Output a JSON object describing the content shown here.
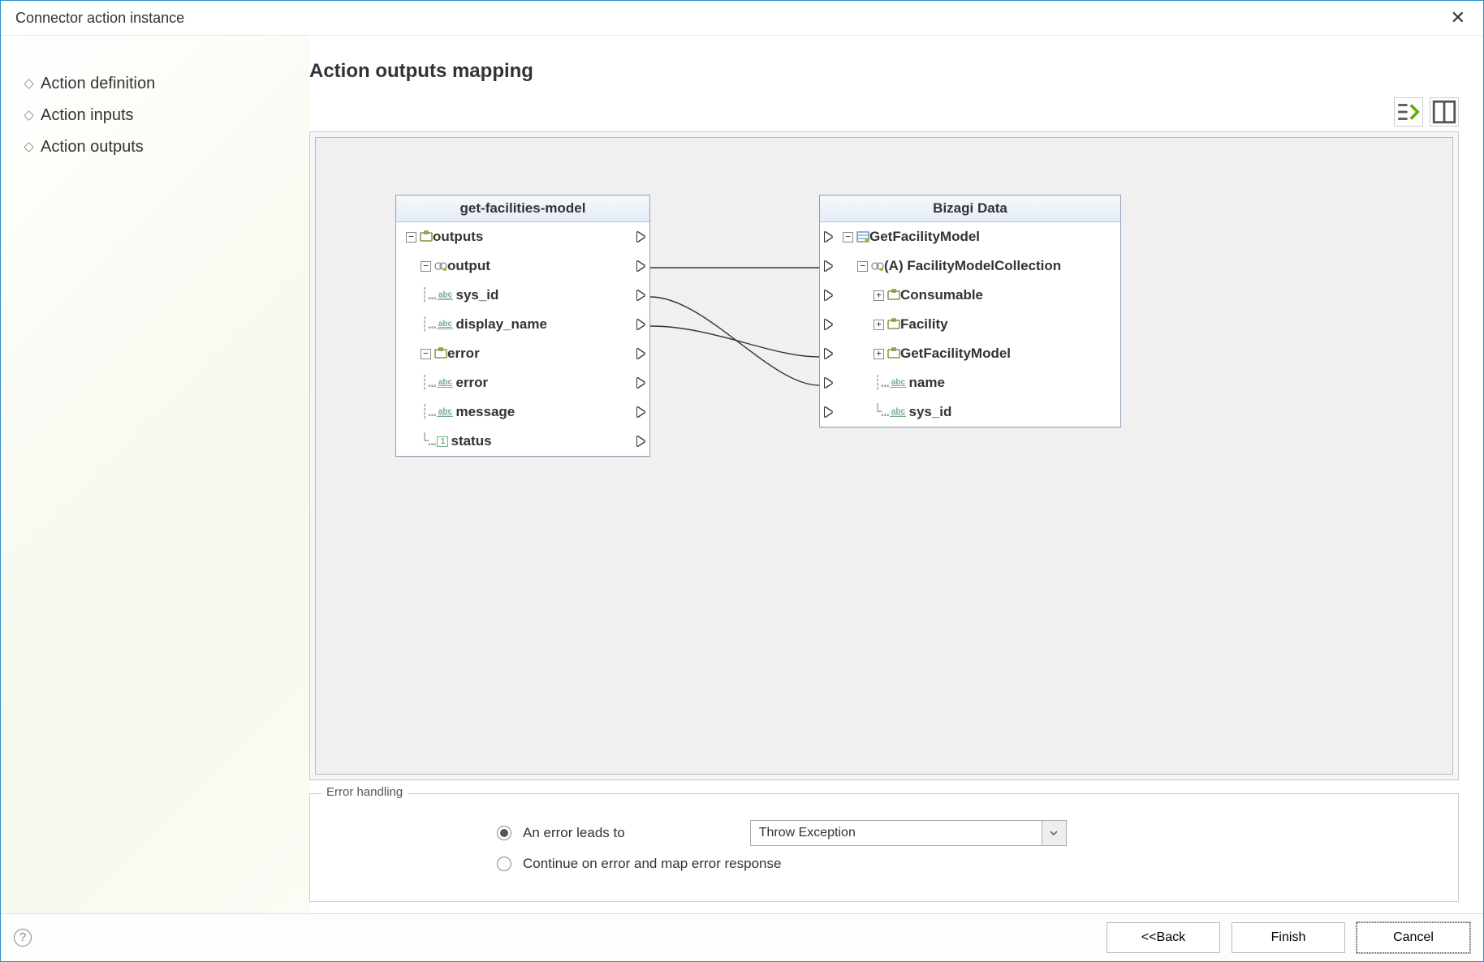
{
  "window": {
    "title": "Connector action instance"
  },
  "sidebar": {
    "items": [
      {
        "label": "Action definition"
      },
      {
        "label": "Action inputs"
      },
      {
        "label": "Action outputs"
      }
    ]
  },
  "main": {
    "heading": "Action outputs mapping"
  },
  "source_panel": {
    "title": "get-facilities-model",
    "rows": [
      {
        "label": "outputs"
      },
      {
        "label": "output"
      },
      {
        "label": "sys_id"
      },
      {
        "label": "display_name"
      },
      {
        "label": "error"
      },
      {
        "label": "error"
      },
      {
        "label": "message"
      },
      {
        "label": "status"
      }
    ]
  },
  "target_panel": {
    "title": "Bizagi Data",
    "rows": [
      {
        "label": "GetFacilityModel"
      },
      {
        "label": "(A) FacilityModelCollection"
      },
      {
        "label": "Consumable"
      },
      {
        "label": "Facility"
      },
      {
        "label": "GetFacilityModel"
      },
      {
        "label": "name"
      },
      {
        "label": "sys_id"
      }
    ]
  },
  "error_handling": {
    "legend": "Error handling",
    "opt1": "An error leads to",
    "opt2": "Continue on error and map error response",
    "select_value": "Throw Exception"
  },
  "footer": {
    "back": "<<Back",
    "finish": "Finish",
    "cancel": "Cancel"
  },
  "icons": {
    "abc": "abc",
    "num": "1"
  }
}
